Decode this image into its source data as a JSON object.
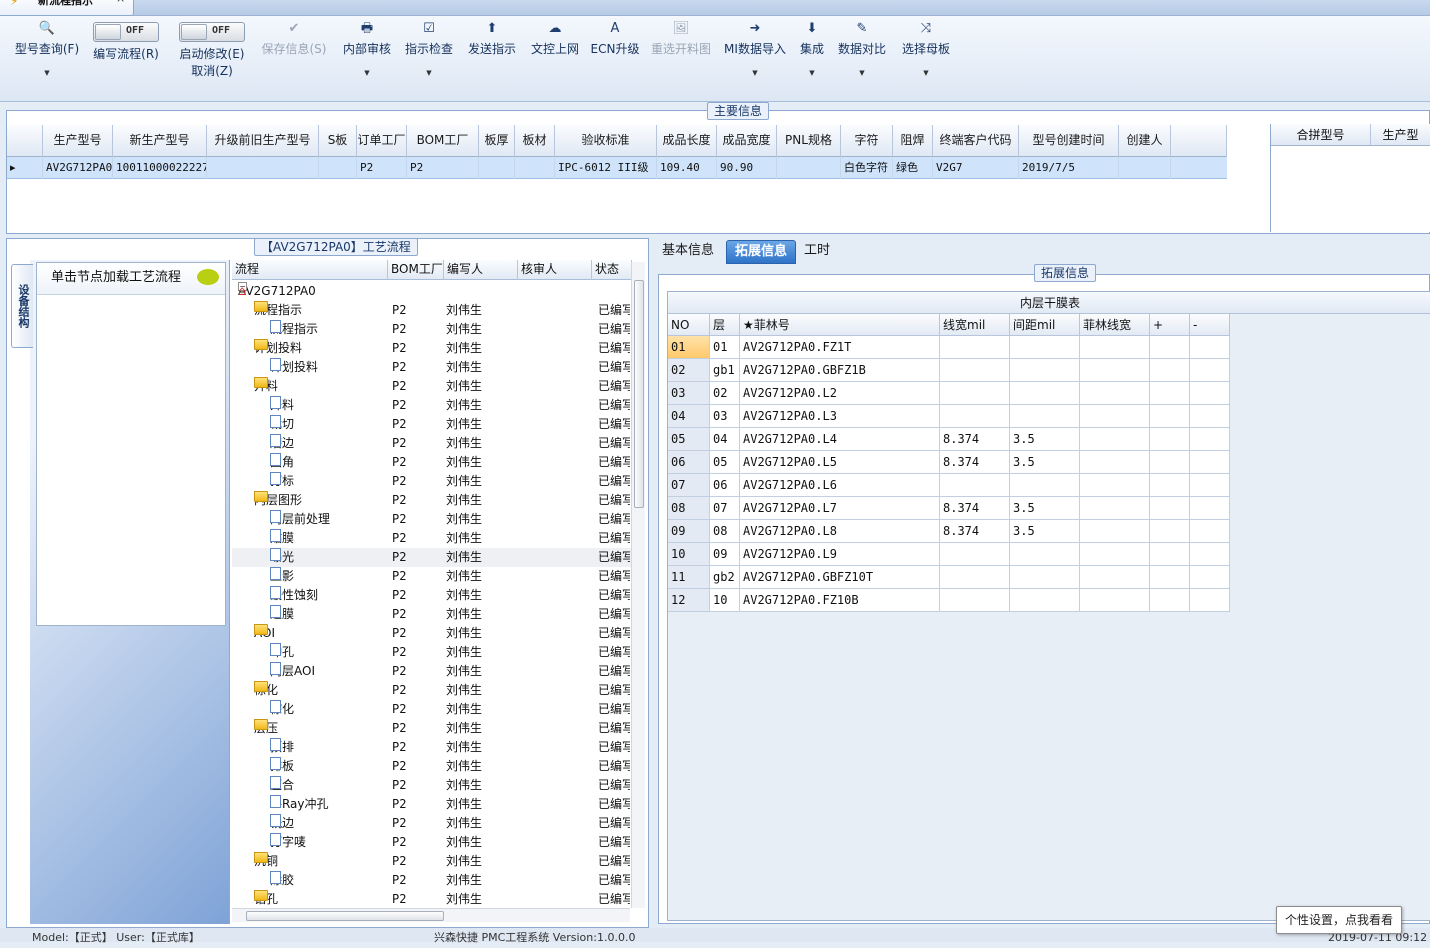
{
  "doc_tab": {
    "title": "新流程指示",
    "close": "×"
  },
  "toolbar": [
    {
      "label": "型号查询(F)",
      "icon": "🔍",
      "name": "search-model-button",
      "arrow": true
    },
    {
      "label": "编写流程(R)",
      "toggle": "OFF",
      "name": "write-flow-toggle"
    },
    {
      "label": "启动修改(E)",
      "label2": "取消(Z)",
      "toggle": "OFF",
      "name": "start-edit-toggle"
    },
    {
      "label": "保存信息(S)",
      "icon": "✔",
      "name": "save-info-button",
      "disabled": true
    },
    {
      "label": "内部审核",
      "icon": "🖶",
      "name": "internal-review-button",
      "arrow": true
    },
    {
      "label": "指示检查",
      "icon": "☑",
      "name": "instruction-check-button",
      "arrow": true
    },
    {
      "label": "发送指示",
      "icon": "⬆",
      "name": "send-instruction-button"
    },
    {
      "label": "文控上网",
      "icon": "☁",
      "name": "doc-control-online-button"
    },
    {
      "label": "ECN升级",
      "icon": "A",
      "name": "ecn-upgrade-button"
    },
    {
      "label": "重选开料图",
      "icon": "🖼",
      "name": "reselect-cut-image-button",
      "disabled": true
    },
    {
      "label": "MI数据导入",
      "icon": "➜",
      "name": "mi-data-import-button",
      "arrow": true
    },
    {
      "label": "集成",
      "icon": "⬇",
      "name": "integrate-button",
      "arrow": true
    },
    {
      "label": "数据对比",
      "icon": "✎",
      "name": "data-compare-button",
      "arrow": true
    },
    {
      "label": "选择母板",
      "icon": "⤨",
      "name": "select-mother-board-button",
      "arrow": true
    }
  ],
  "main_info": {
    "title": "主要信息",
    "columns": [
      "生产型号",
      "新生产型号",
      "升级前旧生产型号",
      "S板",
      "订单工厂",
      "BOM工厂",
      "板厚",
      "板材",
      "验收标准",
      "成品长度",
      "成品宽度",
      "PNL规格",
      "字符",
      "阻焊",
      "终端客户代码",
      "型号创建时间",
      "创建人"
    ],
    "row": [
      "AV2G712PA0",
      "10011000022227",
      "",
      "",
      "P2",
      "P2",
      "",
      "",
      "IPC-6012 III级",
      "109.40",
      "90.90",
      "",
      "白色字符",
      "绿色",
      "V2G7",
      "2019/7/5",
      ""
    ],
    "side_columns": [
      "合拼型号",
      "生产型"
    ]
  },
  "process": {
    "title": "【AV2G712PA0】工艺流程",
    "vertical_tab": "设备结构",
    "load_hint": "单击节点加载工艺流程",
    "columns": [
      "流程",
      "BOM工厂",
      "编写人",
      "核审人",
      "状态"
    ],
    "rows": [
      {
        "level": 0,
        "type": "root",
        "name": "AV2G712PA0",
        "bom": "",
        "writer": "",
        "status": ""
      },
      {
        "level": 1,
        "type": "folder",
        "name": "流程指示",
        "bom": "P2",
        "writer": "刘伟生",
        "status": "已编写"
      },
      {
        "level": 2,
        "type": "doc",
        "name": "流程指示",
        "bom": "P2",
        "writer": "刘伟生",
        "status": "已编写"
      },
      {
        "level": 1,
        "type": "folder",
        "name": "计划投料",
        "bom": "P2",
        "writer": "刘伟生",
        "status": "已编写"
      },
      {
        "level": 2,
        "type": "doc",
        "name": "计划投料",
        "bom": "P2",
        "writer": "刘伟生",
        "status": "已编写"
      },
      {
        "level": 1,
        "type": "folder",
        "name": "开料",
        "bom": "P2",
        "writer": "刘伟生",
        "status": "已编写"
      },
      {
        "level": 2,
        "type": "doc",
        "name": "开料",
        "bom": "P2",
        "writer": "刘伟生",
        "status": "已编写"
      },
      {
        "level": 2,
        "type": "doc",
        "name": "裁切",
        "bom": "P2",
        "writer": "刘伟生",
        "status": "已编写"
      },
      {
        "level": 2,
        "type": "doc",
        "name": "磨边",
        "bom": "P2",
        "writer": "刘伟生",
        "status": "已编写"
      },
      {
        "level": 2,
        "type": "doc",
        "name": "圆角",
        "bom": "P2",
        "writer": "刘伟生",
        "status": "已编写"
      },
      {
        "level": 2,
        "type": "doc",
        "name": "打标",
        "bom": "P2",
        "writer": "刘伟生",
        "status": "已编写"
      },
      {
        "level": 1,
        "type": "folder",
        "name": "内层图形",
        "bom": "P2",
        "writer": "刘伟生",
        "status": "已编写"
      },
      {
        "level": 2,
        "type": "doc",
        "name": "内层前处理",
        "bom": "P2",
        "writer": "刘伟生",
        "status": "已编写"
      },
      {
        "level": 2,
        "type": "doc",
        "name": "贴膜",
        "bom": "P2",
        "writer": "刘伟生",
        "status": "已编写"
      },
      {
        "level": 2,
        "type": "doc",
        "name": "曝光",
        "bom": "P2",
        "writer": "刘伟生",
        "status": "已编写",
        "selected": true
      },
      {
        "level": 2,
        "type": "doc",
        "name": "显影",
        "bom": "P2",
        "writer": "刘伟生",
        "status": "已编写"
      },
      {
        "level": 2,
        "type": "doc",
        "name": "酸性蚀刻",
        "bom": "P2",
        "writer": "刘伟生",
        "status": "已编写"
      },
      {
        "level": 2,
        "type": "doc",
        "name": "退膜",
        "bom": "P2",
        "writer": "刘伟生",
        "status": "已编写"
      },
      {
        "level": 1,
        "type": "folder",
        "name": "AOI",
        "bom": "P2",
        "writer": "刘伟生",
        "status": "已编写"
      },
      {
        "level": 2,
        "type": "doc",
        "name": "冲孔",
        "bom": "P2",
        "writer": "刘伟生",
        "status": "已编写"
      },
      {
        "level": 2,
        "type": "doc",
        "name": "内层AOI",
        "bom": "P2",
        "writer": "刘伟生",
        "status": "已编写"
      },
      {
        "level": 1,
        "type": "folder",
        "name": "棕化",
        "bom": "P2",
        "writer": "刘伟生",
        "status": "已编写"
      },
      {
        "level": 2,
        "type": "doc",
        "name": "棕化",
        "bom": "P2",
        "writer": "刘伟生",
        "status": "已编写"
      },
      {
        "level": 1,
        "type": "folder",
        "name": "层压",
        "bom": "P2",
        "writer": "刘伟生",
        "status": "已编写"
      },
      {
        "level": 2,
        "type": "doc",
        "name": "预排",
        "bom": "P2",
        "writer": "刘伟生",
        "status": "已编写"
      },
      {
        "level": 2,
        "type": "doc",
        "name": "排板",
        "bom": "P2",
        "writer": "刘伟生",
        "status": "已编写"
      },
      {
        "level": 2,
        "type": "doc",
        "name": "压合",
        "bom": "P2",
        "writer": "刘伟生",
        "status": "已编写"
      },
      {
        "level": 2,
        "type": "doc",
        "name": "X-Ray冲孔",
        "bom": "P2",
        "writer": "刘伟生",
        "status": "已编写"
      },
      {
        "level": 2,
        "type": "doc",
        "name": "铣边",
        "bom": "P2",
        "writer": "刘伟生",
        "status": "已编写"
      },
      {
        "level": 2,
        "type": "doc",
        "name": "打字唛",
        "bom": "P2",
        "writer": "刘伟生",
        "status": "已编写"
      },
      {
        "level": 1,
        "type": "folder",
        "name": "沉铜",
        "bom": "P2",
        "writer": "刘伟生",
        "status": "已编写"
      },
      {
        "level": 2,
        "type": "doc",
        "name": "除胶",
        "bom": "P2",
        "writer": "刘伟生",
        "status": "已编写"
      },
      {
        "level": 1,
        "type": "folder",
        "name": "钻孔",
        "bom": "P2",
        "writer": "刘伟生",
        "status": "已编写"
      }
    ]
  },
  "right_tabs": [
    "基本信息",
    "拓展信息",
    "工时"
  ],
  "ext_info": {
    "title": "拓展信息",
    "grid_title": "内层干膜表",
    "columns": [
      "NO",
      "层",
      "★菲林号",
      "线宽mil",
      "间距mil",
      "菲林线宽",
      "+",
      "-"
    ],
    "rows": [
      [
        "01",
        "01",
        "AV2G712PA0.FZ1T",
        "",
        "",
        "",
        "",
        ""
      ],
      [
        "02",
        "gb1",
        "AV2G712PA0.GBFZ1B",
        "",
        "",
        "",
        "",
        ""
      ],
      [
        "03",
        "02",
        "AV2G712PA0.L2",
        "",
        "",
        "",
        "",
        ""
      ],
      [
        "04",
        "03",
        "AV2G712PA0.L3",
        "",
        "",
        "",
        "",
        ""
      ],
      [
        "05",
        "04",
        "AV2G712PA0.L4",
        "8.374",
        "3.5",
        "",
        "",
        ""
      ],
      [
        "06",
        "05",
        "AV2G712PA0.L5",
        "8.374",
        "3.5",
        "",
        "",
        ""
      ],
      [
        "07",
        "06",
        "AV2G712PA0.L6",
        "",
        "",
        "",
        "",
        ""
      ],
      [
        "08",
        "07",
        "AV2G712PA0.L7",
        "8.374",
        "3.5",
        "",
        "",
        ""
      ],
      [
        "09",
        "08",
        "AV2G712PA0.L8",
        "8.374",
        "3.5",
        "",
        "",
        ""
      ],
      [
        "10",
        "09",
        "AV2G712PA0.L9",
        "",
        "",
        "",
        "",
        ""
      ],
      [
        "11",
        "gb2",
        "AV2G712PA0.GBFZ10T",
        "",
        "",
        "",
        "",
        ""
      ],
      [
        "12",
        "10",
        "AV2G712PA0.FZ10B",
        "",
        "",
        "",
        "",
        ""
      ]
    ]
  },
  "status_bar": {
    "left": "Model:【正式】 User:【正式库】",
    "center": "兴森快捷 PMC工程系统 Version:1.0.0.0",
    "right": "2019-07-11 09:12"
  },
  "tooltip": "个性设置，点我看看"
}
